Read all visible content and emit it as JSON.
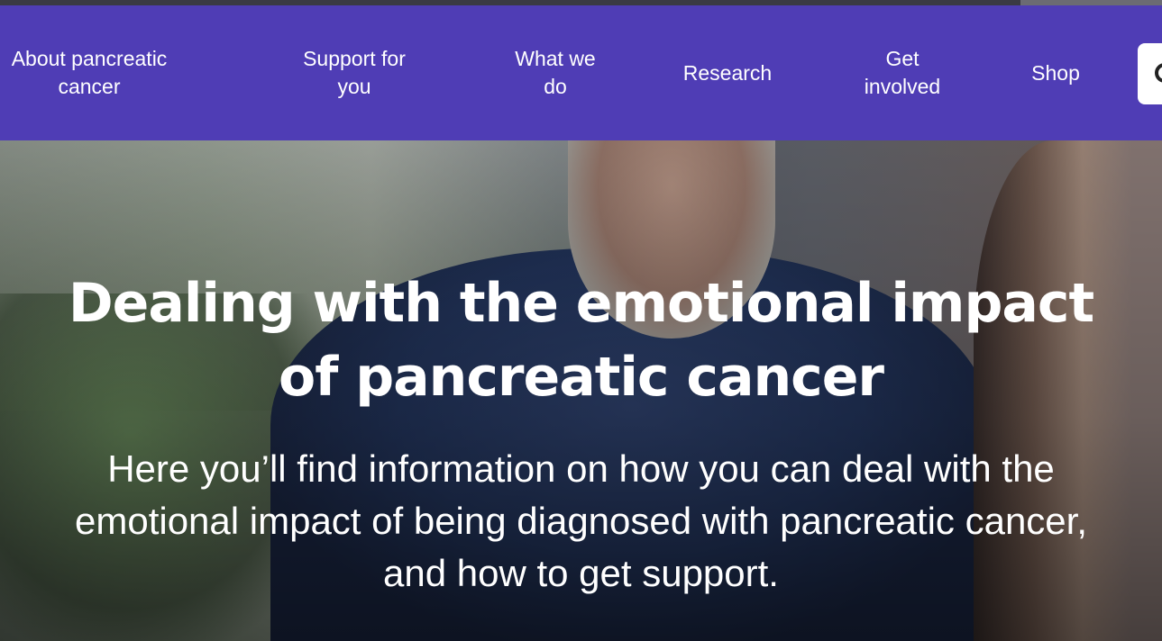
{
  "nav": {
    "items": [
      {
        "line1": "About pancreatic",
        "line2": "cancer"
      },
      {
        "line1": "Support for",
        "line2": "you"
      },
      {
        "line1": "What we",
        "line2": "do"
      },
      {
        "line1": "Research",
        "line2": ""
      },
      {
        "line1": "Get",
        "line2": "involved"
      },
      {
        "line1": "Shop",
        "line2": ""
      }
    ],
    "search_icon": "search-icon"
  },
  "hero": {
    "title": "Dealing with the emotional impact of pancreatic cancer",
    "subtitle": "Here you’ll find information on how you can deal with the emotional impact of being diagnosed with pancreatic cancer, and how to get support."
  },
  "colors": {
    "nav_background": "#4f3db5",
    "text": "#ffffff"
  }
}
